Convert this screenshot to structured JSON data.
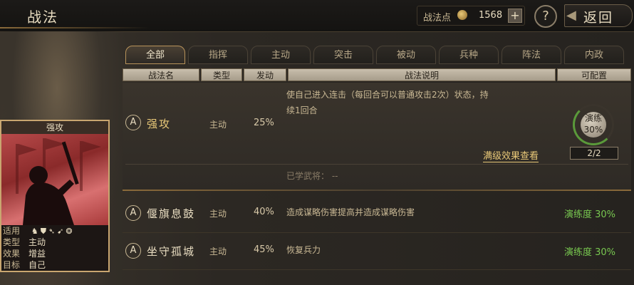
{
  "header": {
    "title": "战法",
    "points_label": "战法点",
    "points_value": "1568",
    "plus": "+",
    "help": "?",
    "back_label": "返回"
  },
  "tabs": [
    "全部",
    "指挥",
    "主动",
    "突击",
    "被动",
    "兵种",
    "阵法",
    "内政"
  ],
  "active_tab": 0,
  "columns": [
    "战法名",
    "类型",
    "发动",
    "战法说明",
    "可配置"
  ],
  "card": {
    "title": "强攻",
    "rows": [
      {
        "key": "适用",
        "value": ""
      },
      {
        "key": "类型",
        "value": "主动"
      },
      {
        "key": "效果",
        "value": "增益"
      },
      {
        "key": "目标",
        "value": "自己"
      }
    ],
    "unit_icons": [
      "horse-icon",
      "shield-icon",
      "bow-icon",
      "spear-icon",
      "wheel-icon"
    ]
  },
  "tactics": [
    {
      "grade": "A",
      "name": "强攻",
      "type": "主动",
      "rate": "25%",
      "desc_line1": "使自己进入连击（每回合可以普通攻击2次）状态，持",
      "desc_line2": "续1回合",
      "detail_link": "满级效果查看",
      "learned": "已学武将：  --",
      "orb_label_1": "演练",
      "orb_label_2": "30%",
      "orb_count": "2/2"
    },
    {
      "grade": "A",
      "name": "偃旗息鼓",
      "type": "主动",
      "rate": "40%",
      "desc": "造成谋略伤害提高并造成谋略伤害",
      "progress": "演练度 30%"
    },
    {
      "grade": "A",
      "name": "坐守孤城",
      "type": "主动",
      "rate": "45%",
      "desc": "恢复兵力",
      "progress": "演练度 30%"
    }
  ],
  "colors": {
    "accent": "#e8c878",
    "progress": "#78c850",
    "header_bg": "#c8beac"
  }
}
